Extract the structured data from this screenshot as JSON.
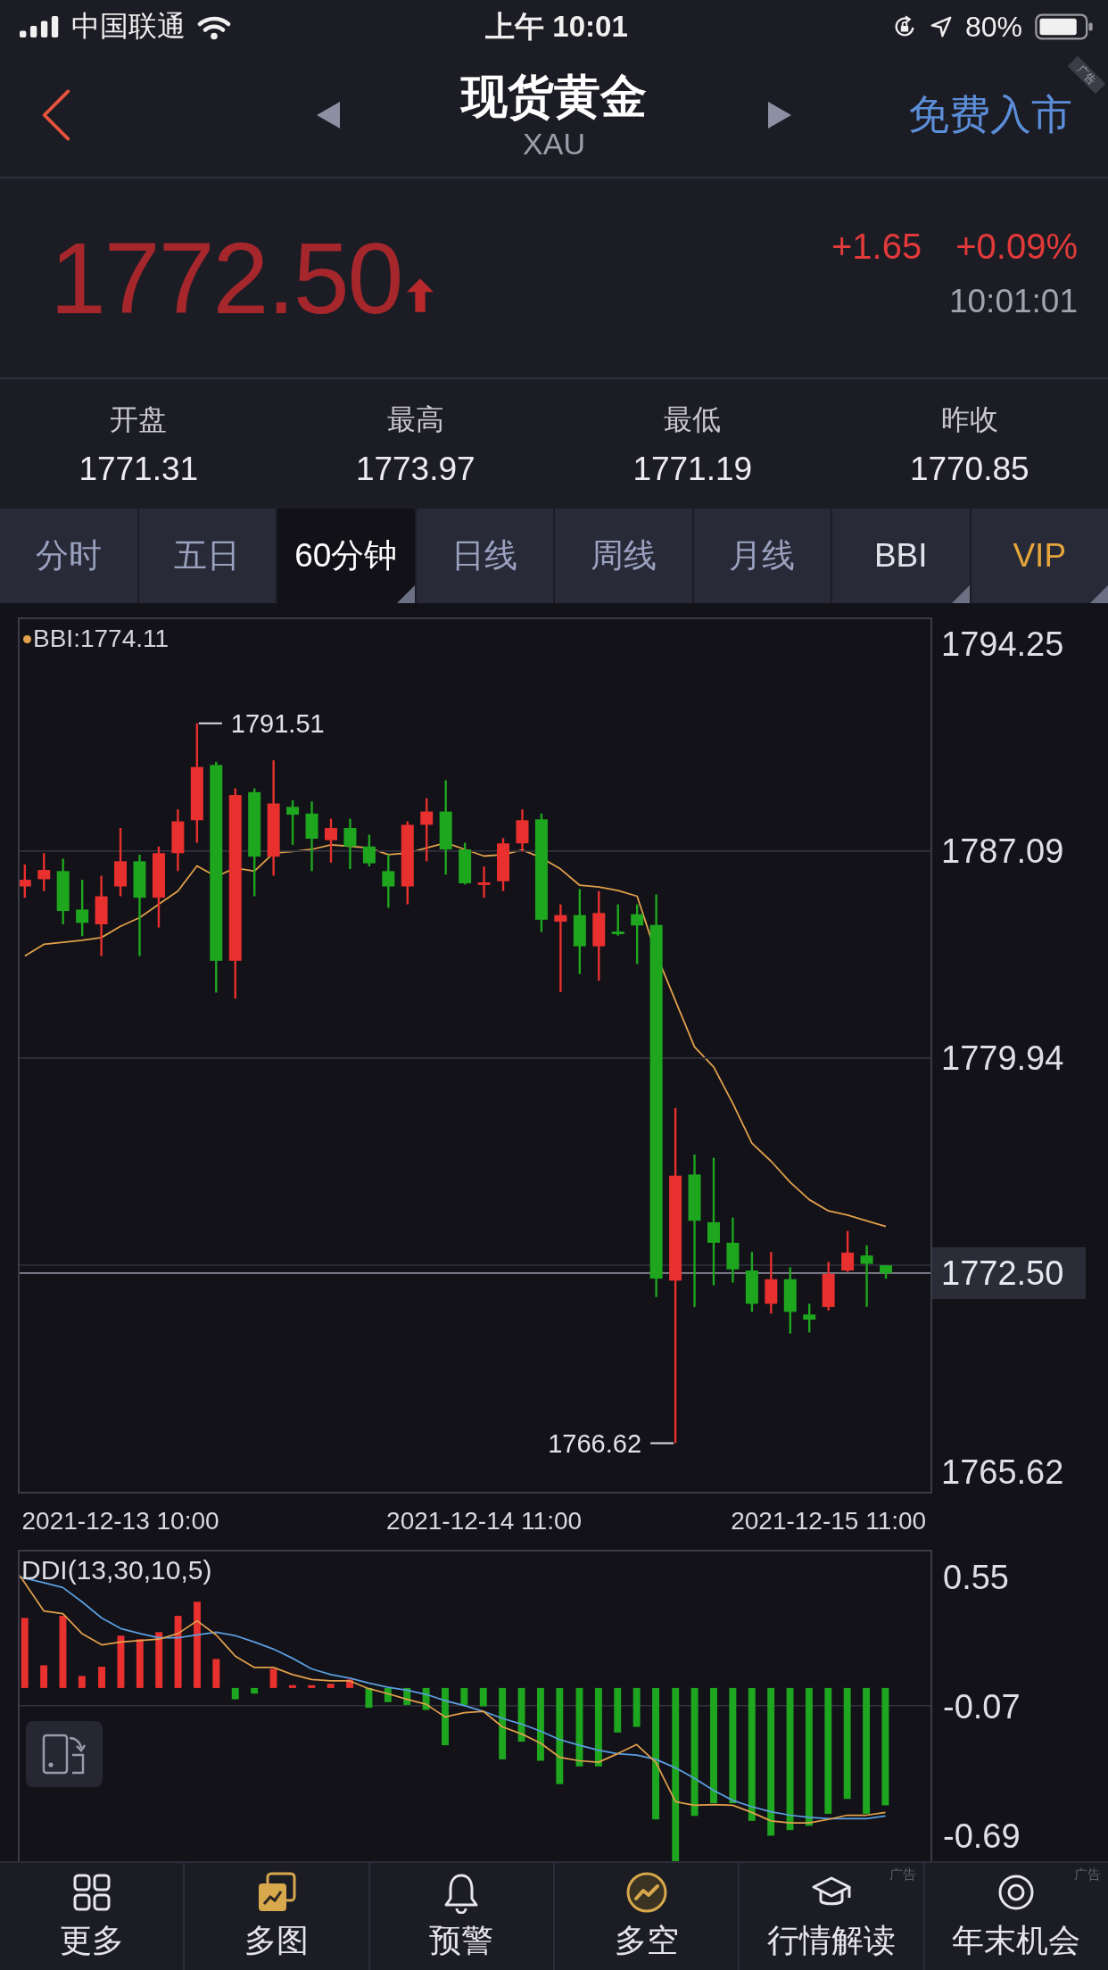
{
  "status_bar": {
    "carrier": "中国联通",
    "time": "上午 10:01",
    "battery": "80%"
  },
  "header": {
    "title": "现货黄金",
    "subtitle": "XAU",
    "action": "免费入市",
    "ad_tag": "广告"
  },
  "quote": {
    "price": "1772.50",
    "rising": true,
    "change": "+1.65",
    "change_percent": "+0.09%",
    "time": "10:01:01"
  },
  "stats": [
    {
      "label": "开盘",
      "value": "1771.31"
    },
    {
      "label": "最高",
      "value": "1773.97"
    },
    {
      "label": "最低",
      "value": "1771.19"
    },
    {
      "label": "昨收",
      "value": "1770.85"
    }
  ],
  "tabs": [
    {
      "label": "分时",
      "kind": "period",
      "selected": false,
      "has_menu": false
    },
    {
      "label": "五日",
      "kind": "period",
      "selected": false,
      "has_menu": false
    },
    {
      "label": "60分钟",
      "kind": "period",
      "selected": true,
      "has_menu": true
    },
    {
      "label": "日线",
      "kind": "period",
      "selected": false,
      "has_menu": false
    },
    {
      "label": "周线",
      "kind": "period",
      "selected": false,
      "has_menu": false
    },
    {
      "label": "月线",
      "kind": "period",
      "selected": false,
      "has_menu": false
    },
    {
      "label": "BBI",
      "kind": "indicator",
      "selected": false,
      "has_menu": true
    },
    {
      "label": "VIP",
      "kind": "vip",
      "selected": false,
      "has_menu": true
    }
  ],
  "price_chart": {
    "legend": "BBI:1774.11",
    "current_price": "1772.50",
    "high_label": "1791.51",
    "low_label": "1766.62",
    "chart_data": {
      "type": "candlestick",
      "categories": [
        null,
        null,
        null,
        null,
        null,
        "2021-12-13 10:00",
        null,
        null,
        null,
        null,
        null,
        null,
        null,
        null,
        null,
        null,
        null,
        null,
        null,
        null,
        null,
        null,
        null,
        null,
        "2021-12-14 11:00",
        null,
        null,
        null,
        null,
        null,
        null,
        null,
        null,
        null,
        null,
        null,
        null,
        null,
        null,
        null,
        null,
        null,
        "2021-12-15 11:00",
        null,
        null,
        null
      ],
      "ohlc": [
        [
          1785.87,
          1786.63,
          1785.48,
          1786.1
        ],
        [
          1786.12,
          1787.02,
          1785.71,
          1786.44
        ],
        [
          1786.4,
          1786.83,
          1784.56,
          1785.02
        ],
        [
          1785.07,
          1786.1,
          1784.15,
          1784.61
        ],
        [
          1784.56,
          1786.24,
          1783.46,
          1785.53
        ],
        [
          1785.87,
          1787.89,
          1785.53,
          1786.74
        ],
        [
          1786.74,
          1786.97,
          1783.46,
          1785.48
        ],
        [
          1785.48,
          1787.25,
          1784.45,
          1787.02
        ],
        [
          1787.02,
          1788.53,
          1786.4,
          1788.12
        ],
        [
          1788.16,
          1791.51,
          1787.38,
          1790.0
        ],
        [
          1790.07,
          1790.18,
          1782.2,
          1783.3
        ],
        [
          1783.3,
          1789.26,
          1781.99,
          1789.03
        ],
        [
          1789.13,
          1789.26,
          1785.53,
          1786.9
        ],
        [
          1786.9,
          1790.23,
          1786.24,
          1788.74
        ],
        [
          1788.62,
          1788.85,
          1787.31,
          1788.35
        ],
        [
          1788.39,
          1788.81,
          1786.4,
          1787.52
        ],
        [
          1787.47,
          1788.21,
          1786.69,
          1787.89
        ],
        [
          1787.89,
          1788.21,
          1786.47,
          1787.25
        ],
        [
          1787.25,
          1787.66,
          1786.56,
          1786.67
        ],
        [
          1786.4,
          1786.97,
          1785.13,
          1785.87
        ],
        [
          1785.87,
          1788.12,
          1785.25,
          1788.0
        ],
        [
          1788.0,
          1788.92,
          1786.74,
          1788.46
        ],
        [
          1788.46,
          1789.54,
          1786.28,
          1787.15
        ],
        [
          1787.15,
          1787.38,
          1785.94,
          1785.98
        ],
        [
          1785.92,
          1786.56,
          1785.48,
          1786.01
        ],
        [
          1786.05,
          1787.54,
          1785.71,
          1787.36
        ],
        [
          1787.36,
          1788.53,
          1787.08,
          1788.16
        ],
        [
          1788.19,
          1788.39,
          1784.29,
          1784.72
        ],
        [
          1784.65,
          1785.25,
          1782.22,
          1784.88
        ],
        [
          1784.88,
          1785.78,
          1782.84,
          1783.8
        ],
        [
          1783.8,
          1785.71,
          1782.61,
          1784.95
        ],
        [
          1784.31,
          1785.25,
          1784.17,
          1784.22
        ],
        [
          1784.91,
          1785.25,
          1783.19,
          1784.52
        ],
        [
          1784.54,
          1785.59,
          1771.67,
          1772.31
        ],
        [
          1772.24,
          1778.21,
          1766.62,
          1775.87
        ],
        [
          1775.91,
          1776.6,
          1771.33,
          1774.31
        ],
        [
          1774.26,
          1776.49,
          1772.08,
          1773.55
        ],
        [
          1773.55,
          1774.42,
          1772.17,
          1772.63
        ],
        [
          1772.59,
          1773.23,
          1771.16,
          1771.44
        ],
        [
          1771.44,
          1773.23,
          1771.1,
          1772.29
        ],
        [
          1772.29,
          1772.7,
          1770.41,
          1771.16
        ],
        [
          1771.07,
          1771.44,
          1770.45,
          1770.89
        ],
        [
          1771.33,
          1772.89,
          1771.21,
          1772.47
        ],
        [
          1772.59,
          1773.96,
          1772.54,
          1773.21
        ],
        [
          1773.11,
          1773.46,
          1771.33,
          1772.82
        ],
        [
          1772.77,
          1772.77,
          1772.31,
          1772.5
        ]
      ],
      "ylim": [
        1764.94,
        1795.11
      ],
      "yticks": [
        1794.25,
        1787.09,
        1779.94,
        1765.62
      ]
    }
  },
  "indicator_chart": {
    "title": "DDI(13,30,10,5)",
    "y_labels": [
      "0.55",
      "-0.07",
      "-0.69"
    ]
  },
  "bottom_nav": [
    {
      "label": "更多"
    },
    {
      "label": "多图"
    },
    {
      "label": "预警"
    },
    {
      "label": "多空"
    },
    {
      "label": "行情解读",
      "ad_tag": "广告"
    },
    {
      "label": "年末机会",
      "ad_tag": "广告"
    }
  ]
}
